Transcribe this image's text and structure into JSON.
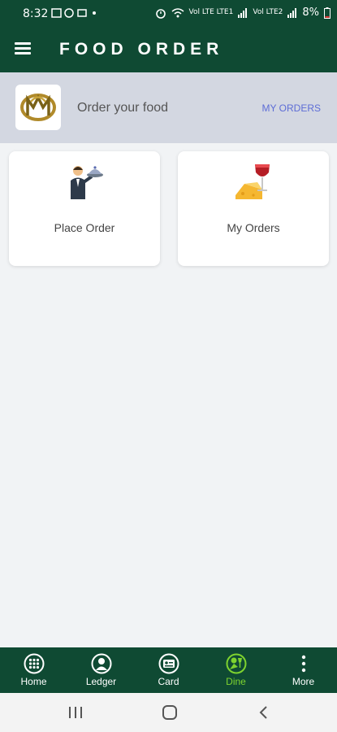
{
  "status_bar": {
    "time": "8:32",
    "battery": "8%",
    "net1": "Vol LTE LTE1",
    "net2": "Vol LTE2"
  },
  "app_bar": {
    "title": "FOOD ORDER"
  },
  "header": {
    "text": "Order your food",
    "link": "MY ORDERS"
  },
  "cards": [
    {
      "label": "Place Order",
      "icon": "waiter-icon"
    },
    {
      "label": "My Orders",
      "icon": "wine-cheese-icon"
    }
  ],
  "bottom_nav": [
    {
      "label": "Home",
      "icon": "grid-icon",
      "active": false
    },
    {
      "label": "Ledger",
      "icon": "person-icon",
      "active": false
    },
    {
      "label": "Card",
      "icon": "card-icon",
      "active": false
    },
    {
      "label": "Dine",
      "icon": "dine-icon",
      "active": true
    },
    {
      "label": "More",
      "icon": "more-icon",
      "active": false
    }
  ],
  "colors": {
    "primary": "#0f4a33",
    "accent_link": "#5d6dd6",
    "active_nav": "#7ed32f"
  }
}
